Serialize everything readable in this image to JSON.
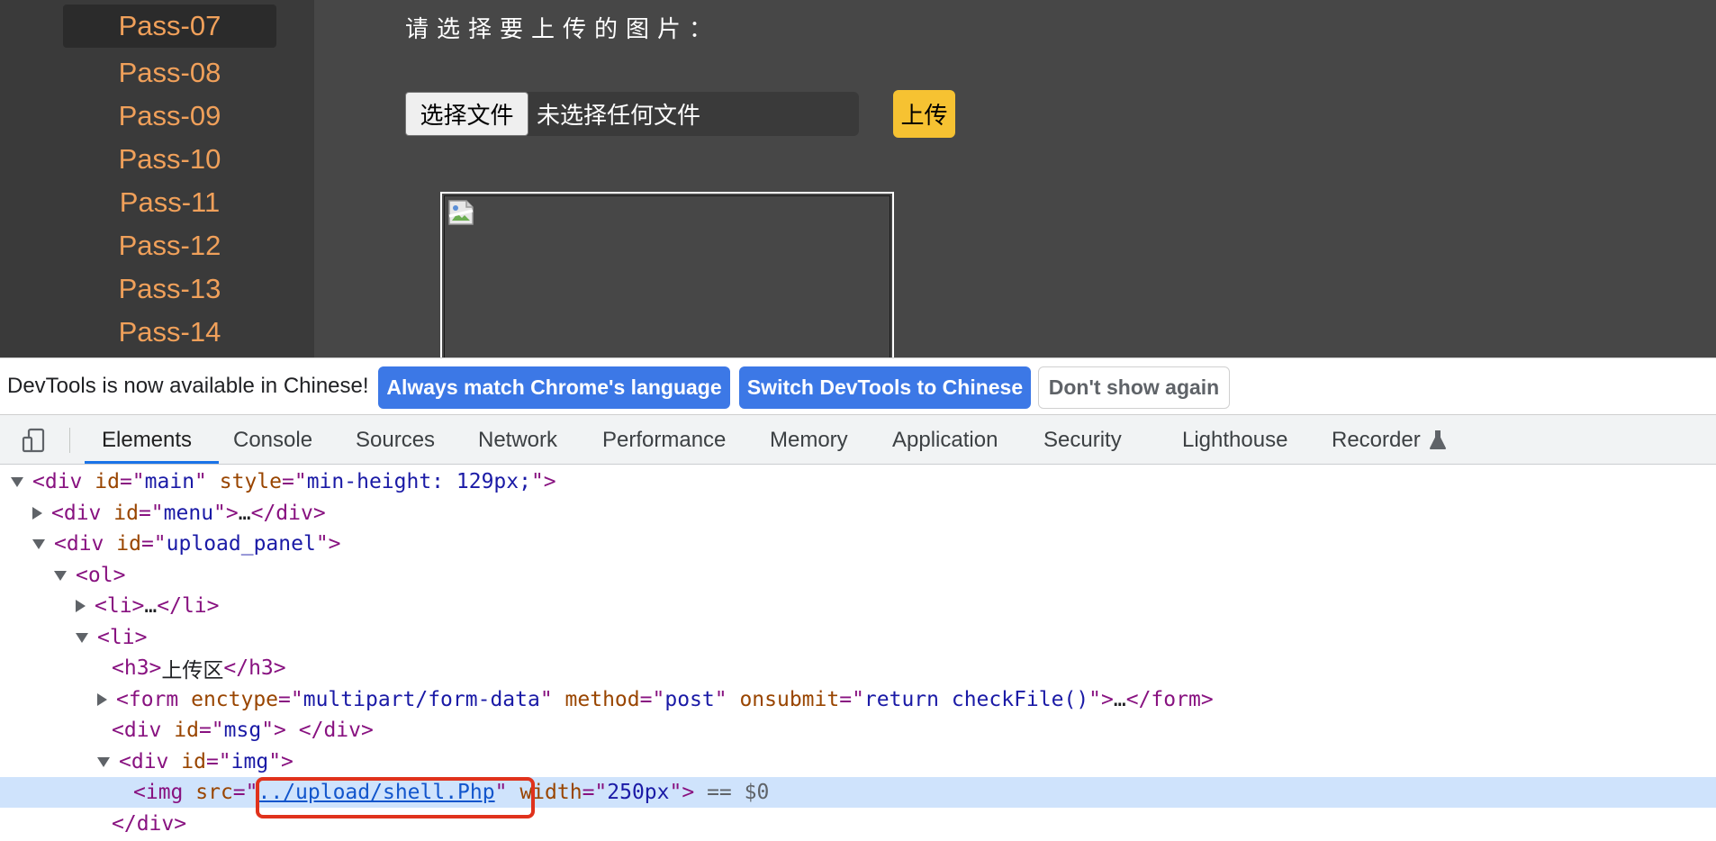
{
  "page": {
    "sidebar_items": [
      "Pass-07",
      "Pass-08",
      "Pass-09",
      "Pass-10",
      "Pass-11",
      "Pass-12",
      "Pass-13",
      "Pass-14"
    ],
    "active_item": "Pass-07",
    "upload_prompt": "请选择要上传的图片：",
    "choose_file_label": "选择文件",
    "no_file_text": "未选择任何文件",
    "upload_label": "上传",
    "colors": {
      "sidebar_link": "#f0a05a",
      "upload_button": "#f6c232"
    }
  },
  "infobar": {
    "message": "DevTools is now available in Chinese!",
    "match_language_label": "Always match Chrome's language",
    "switch_label": "Switch DevTools to Chinese",
    "dont_show_label": "Don't show again"
  },
  "devtools": {
    "tabs": [
      "Elements",
      "Console",
      "Sources",
      "Network",
      "Performance",
      "Memory",
      "Application",
      "Security",
      "Lighthouse",
      "Recorder"
    ],
    "active_tab": "Elements",
    "device_icon": "device-toolbar-icon",
    "recorder_icon": "flask-icon"
  },
  "tree": {
    "main": {
      "tag": "div",
      "id_attr": "id",
      "id_val": "main",
      "style_attr": "style",
      "style_val": "min-height: 129px;"
    },
    "menu": {
      "open": "<div ",
      "attr": "id",
      "val": "menu",
      "collapsed": "…",
      "close": "</div>"
    },
    "upload_panel": {
      "attr": "id",
      "val": "upload_panel"
    },
    "ol": "ol",
    "li_collapsed": "…",
    "li": "li",
    "h3_text": "上传区",
    "form": {
      "enctype_attr": "enctype",
      "enctype_val": "multipart/form-data",
      "method_attr": "method",
      "method_val": "post",
      "onsubmit_attr": "onsubmit",
      "onsubmit_val": "return checkFile()"
    },
    "msg": {
      "attr": "id",
      "val": "msg"
    },
    "img_div": {
      "attr": "id",
      "val": "img"
    },
    "img": {
      "src_attr": "src",
      "src_val": "../upload/shell.Php",
      "width_attr": "width",
      "width_val": "250px",
      "suffix": "== $0"
    }
  }
}
